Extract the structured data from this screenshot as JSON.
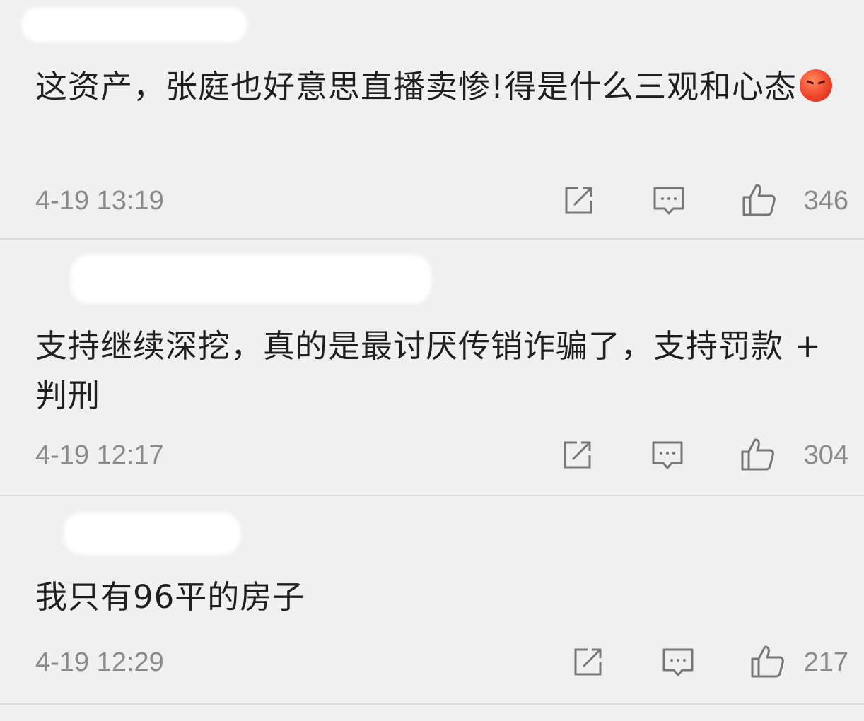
{
  "comments": [
    {
      "text": "这资产，张庭也好意思直播卖惨!得是什么三观和心态",
      "emoji": "angry-face",
      "time": "4-19 13:19",
      "likes": "346"
    },
    {
      "text": "支持继续深挖，真的是最讨厌传销诈骗了，支持罚款 + 判刑",
      "emoji": "",
      "time": "4-19 12:17",
      "likes": "304"
    },
    {
      "text": "我只有96平的房子",
      "emoji": "",
      "time": "4-19 12:29",
      "likes": "217"
    }
  ],
  "icons": {
    "share": "share-icon",
    "comment": "comment-icon",
    "like": "thumbs-up-icon"
  },
  "colors": {
    "background": "#f0f0f0",
    "text": "#1f1f1f",
    "meta": "#8a8a8a"
  }
}
